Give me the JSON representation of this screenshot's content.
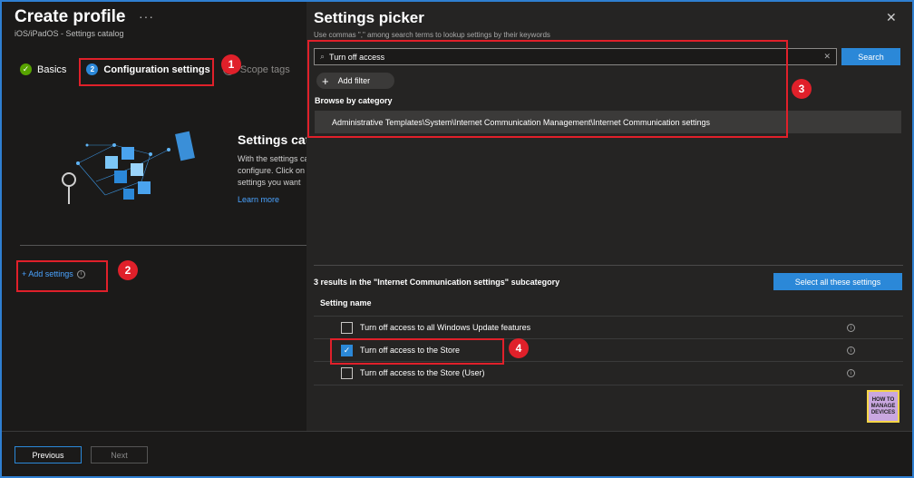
{
  "header": {
    "title": "Create profile",
    "more": "···",
    "subtitle": "iOS/iPadOS - Settings catalog"
  },
  "steps": [
    {
      "label": "Basics",
      "marker": "✓"
    },
    {
      "label": "Configuration settings",
      "marker": "2"
    },
    {
      "label": "Scope tags",
      "marker": ""
    }
  ],
  "catalog": {
    "title": "Settings catalog",
    "desc_lines": [
      "With the settings catalog,",
      "configure. Click on",
      "settings you want"
    ],
    "learn_more": "Learn more",
    "add_settings": "+ Add settings",
    "info": "i"
  },
  "footer": {
    "previous": "Previous",
    "next": "Next"
  },
  "picker": {
    "title": "Settings picker",
    "close": "✕",
    "hint": "Use commas \",\" among search terms to lookup settings by their keywords",
    "search_value": "Turn off access",
    "search_clear": "✕",
    "search_button": "Search",
    "add_filter": "Add filter",
    "browse_label": "Browse by category",
    "category_path": "Administrative Templates\\System\\Internet Communication Management\\Internet Communication settings",
    "results_text": "3 results in the \"Internet Communication settings\" subcategory",
    "select_all": "Select all these settings",
    "column_header": "Setting name",
    "rows": [
      {
        "name": "Turn off access to all Windows Update features",
        "checked": false,
        "info": "i"
      },
      {
        "name": "Turn off access to the Store",
        "checked": true,
        "info": "i"
      },
      {
        "name": "Turn off access to the Store (User)",
        "checked": false,
        "info": "i"
      }
    ]
  },
  "callouts": [
    "1",
    "2",
    "3",
    "4"
  ],
  "logo": {
    "line1": "HOW TO",
    "line2": "MANAGE",
    "line3": "DEVICES"
  },
  "colors": {
    "accent": "#2b88d8",
    "callout": "#e0202a",
    "success": "#57a300",
    "frame": "#2f7fd1"
  }
}
